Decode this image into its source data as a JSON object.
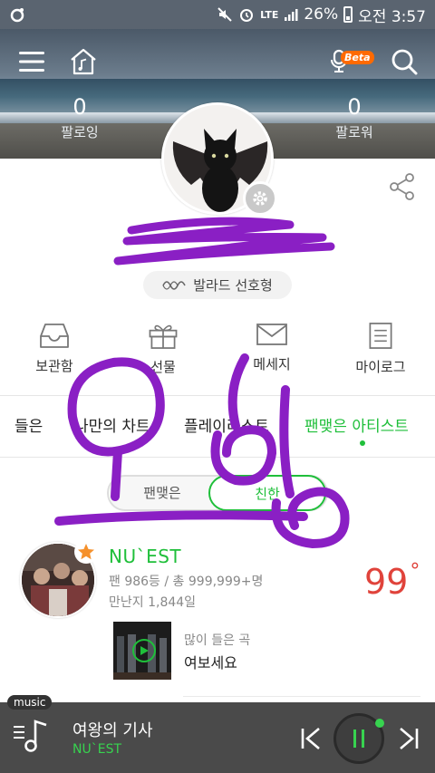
{
  "status_bar": {
    "network": "LTE",
    "battery": "26%",
    "time": "오전 3:57"
  },
  "header": {
    "beta_label": "Beta"
  },
  "stats": {
    "following": {
      "count": "0",
      "label": "팔로잉"
    },
    "followers": {
      "count": "0",
      "label": "팔로워"
    }
  },
  "profile": {
    "genre_tag": "발라드 선호형"
  },
  "quick_menu": [
    {
      "label": "보관함",
      "icon": "inbox-icon"
    },
    {
      "label": "선물",
      "icon": "gift-icon"
    },
    {
      "label": "메세지",
      "icon": "mail-icon"
    },
    {
      "label": "마이로그",
      "icon": "log-icon"
    }
  ],
  "tabs": [
    {
      "label": "들은"
    },
    {
      "label": "나만의 차트"
    },
    {
      "label": "플레이리스트"
    },
    {
      "label": "팬맺은 아티스트"
    }
  ],
  "toggle": {
    "option1": "팬맺은",
    "option2": "친한"
  },
  "artist": {
    "name": "NU`EST",
    "fan_info": "팬 986등 / 총 999,999+명",
    "days_info": "만난지 1,844일",
    "temperature": "99"
  },
  "song": {
    "subtitle": "많이 들은 곡",
    "title": "여보세요"
  },
  "player": {
    "tag": "music",
    "title": "여왕의 기사",
    "artist": "NU`EST"
  },
  "colors": {
    "accent": "#1fbf3a",
    "temperature": "#e0433b",
    "scribble": "#8a1fc4",
    "beta": "#ff6a00"
  }
}
